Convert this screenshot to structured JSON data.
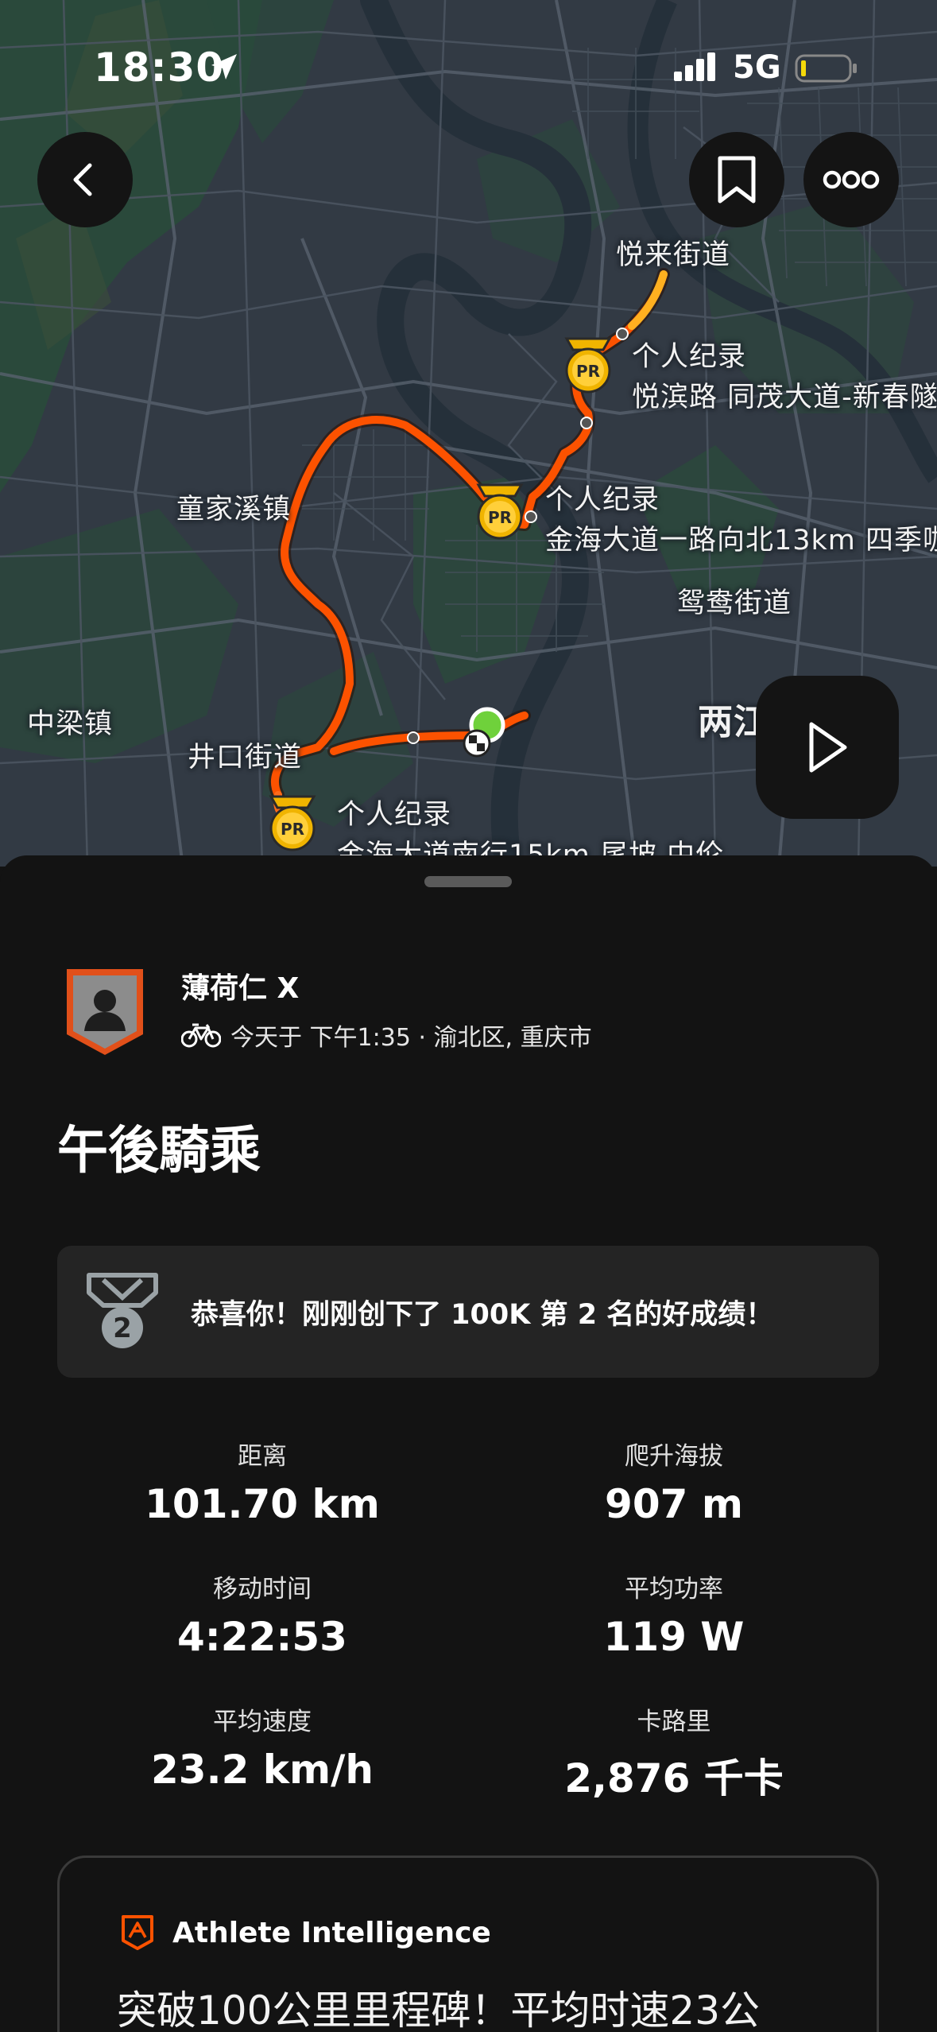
{
  "status_bar": {
    "time": "18:30",
    "network": "5G"
  },
  "map": {
    "route_color": "#fc5200",
    "labels": {
      "yuelai": "悦来街道",
      "tongjiaxi": "童家溪镇",
      "yuanyang": "鸳鸯街道",
      "zhongliang": "中梁镇",
      "jingkou": "井口街道",
      "liangjiang": "两江"
    },
    "records": [
      {
        "title": "个人纪录",
        "segment": "悦滨路 同茂大道-新春隧"
      },
      {
        "title": "个人纪录",
        "segment": "金海大道一路向北13km 四季咖"
      },
      {
        "title": "个人纪录",
        "segment": "金海大道南行15km 尾坡 中伦"
      }
    ],
    "pr_badge_text": "PR",
    "buttons": {
      "back": "back-chevron-icon",
      "save": "bookmark-icon",
      "more": "more-dots-icon",
      "play": "play-icon"
    }
  },
  "athlete": {
    "name": "薄荷仁 X",
    "meta": "今天于 下午1:35 · 渝北区, 重庆市",
    "activity_icon": "bike-icon"
  },
  "activity": {
    "title": "午後騎乘",
    "achievement": {
      "rank": "2",
      "message": "恭喜你！刚刚创下了 100K 第 2 名的好成绩！"
    }
  },
  "stats": [
    {
      "label": "距离",
      "value": "101.70 km"
    },
    {
      "label": "爬升海拔",
      "value": "907 m"
    },
    {
      "label": "移动时间",
      "value": "4:22:53"
    },
    {
      "label": "平均功率",
      "value": "119 W"
    },
    {
      "label": "平均速度",
      "value": "23.2 km/h"
    },
    {
      "label": "卡路里",
      "value": "2,876 千卡"
    }
  ],
  "athlete_intelligence": {
    "title": "Athlete Intelligence",
    "text": "突破100公里里程碑！平均时速23公"
  }
}
